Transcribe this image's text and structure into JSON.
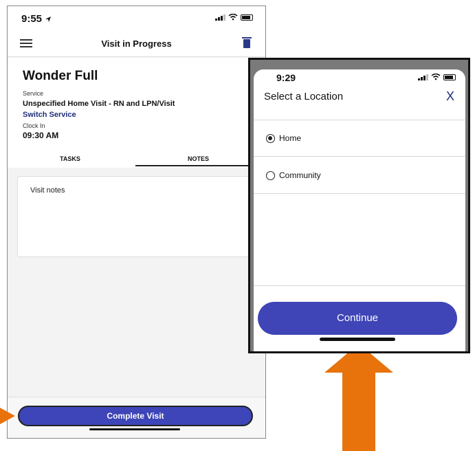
{
  "left_phone": {
    "status": {
      "time": "9:55"
    },
    "nav": {
      "title": "Visit in Progress"
    },
    "visit": {
      "client_name": "Wonder Full",
      "service_label": "Service",
      "service_value": "Unspecified Home Visit - RN and LPN/Visit",
      "switch_service": "Switch Service",
      "clock_in_label": "Clock In",
      "clock_in_value": "09:30 AM"
    },
    "tabs": [
      {
        "label": "TASKS"
      },
      {
        "label": "NOTES"
      }
    ],
    "notes": {
      "placeholder": "Visit notes"
    },
    "complete_button": "Complete Visit"
  },
  "modal": {
    "status": {
      "time": "9:29"
    },
    "title": "Select a Location",
    "close": "X",
    "options": [
      {
        "label": "Home",
        "selected": true
      },
      {
        "label": "Community",
        "selected": false
      }
    ],
    "continue_button": "Continue"
  },
  "colors": {
    "accent": "#3e45b8",
    "link": "#1f2f7a",
    "arrow": "#e8720c"
  },
  "icons": [
    "navigation-arrow-icon",
    "signal-icon",
    "wifi-icon",
    "battery-icon",
    "hamburger-menu-icon",
    "trash-icon",
    "close-icon",
    "radio-icon"
  ]
}
